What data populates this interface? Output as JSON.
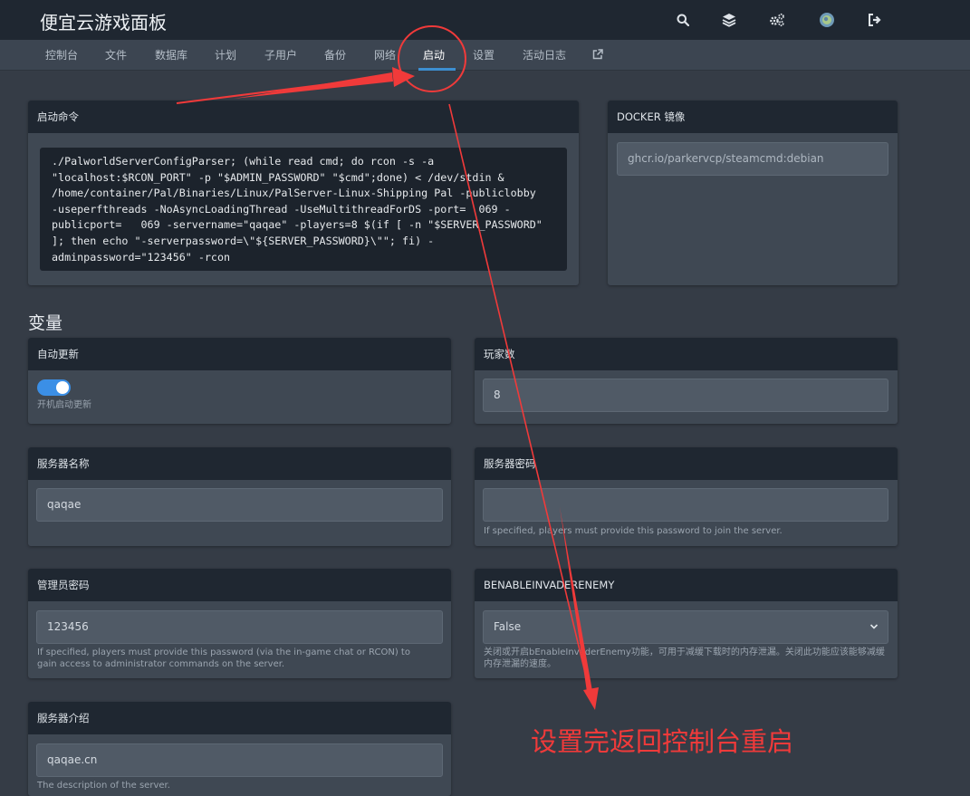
{
  "app": {
    "title": "便宜云游戏面板"
  },
  "header_icons": [
    "search-icon",
    "layers-icon",
    "cogs-icon",
    "avatar",
    "logout-icon"
  ],
  "nav": {
    "items": [
      {
        "label": "控制台"
      },
      {
        "label": "文件"
      },
      {
        "label": "数据库"
      },
      {
        "label": "计划"
      },
      {
        "label": "子用户"
      },
      {
        "label": "备份"
      },
      {
        "label": "网络"
      },
      {
        "label": "启动",
        "active": true
      },
      {
        "label": "设置"
      },
      {
        "label": "活动日志"
      }
    ],
    "external_link_icon": "external-link-icon"
  },
  "startup": {
    "title": "启动命令",
    "command_lines": [
      "./PalworldServerConfigParser; (while read cmd; do rcon -s -a",
      "\"localhost:$RCON_PORT\" -p \"$ADMIN_PASSWORD\" \"$cmd\";done) < /dev/stdin &",
      "/home/container/Pal/Binaries/Linux/PalServer-Linux-Shipping Pal -publiclobby",
      "-useperfthreads -NoAsyncLoadingThread -UseMultithreadForDS -port=  069 -",
      "publicport=   069 -servername=\"qaqae\" -players=8 $(if [ -n \"$SERVER_PASSWORD\"",
      "]; then echo \"-serverpassword=\\\"${SERVER_PASSWORD}\\\"\"; fi) -",
      "adminpassword=\"123456\" -rcon"
    ]
  },
  "docker": {
    "title": "DOCKER 镜像",
    "value": "ghcr.io/parkervcp/steamcmd:debian"
  },
  "variables": {
    "section_title": "变量",
    "auto_update": {
      "title": "自动更新",
      "enabled": true,
      "help": "开机启动更新"
    },
    "players": {
      "title": "玩家数",
      "value": "8"
    },
    "server_name": {
      "title": "服务器名称",
      "value": "qaqae"
    },
    "server_password": {
      "title": "服务器密码",
      "value": "",
      "help": "If specified, players must provide this password to join the server."
    },
    "admin_password": {
      "title": "管理员密码",
      "value": "123456",
      "help": "If specified, players must provide this password (via the in-game chat or RCON) to gain access to administrator commands on the server."
    },
    "invader_enemy": {
      "title": "BENABLEINVADERENEMY",
      "value": "False",
      "help": "关闭或开启bEnableInvaderEnemy功能，可用于减缓下载时的内存泄漏。关闭此功能应该能够减缓内存泄漏的速度。"
    },
    "server_description": {
      "title": "服务器介绍",
      "value": "qaqae.cn",
      "help": "The description of the server."
    }
  },
  "annotation": {
    "text": "设置完返回控制台重启",
    "color": "#f03a3a"
  },
  "colors": {
    "accent": "#3d8fd1",
    "toggle_on": "#3b8fe6",
    "annotation": "#f03a3a"
  }
}
